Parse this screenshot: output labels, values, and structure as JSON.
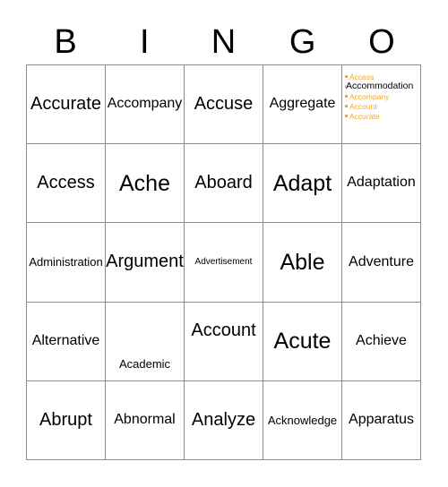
{
  "card": {
    "header_letters": [
      "B",
      "I",
      "N",
      "G",
      "O"
    ],
    "rows": [
      [
        {
          "text": "Accurate",
          "size": "sz-lg",
          "align": "middle"
        },
        {
          "text": "Accompany",
          "size": "sz-md",
          "align": "middle"
        },
        {
          "text": "Accuse",
          "size": "sz-lg",
          "align": "middle"
        },
        {
          "text": "Aggregate",
          "size": "sz-md",
          "align": "middle"
        },
        {
          "text": "",
          "size": "sz-md",
          "align": "middle"
        }
      ],
      [
        {
          "text": "Access",
          "size": "sz-lg",
          "align": "middle"
        },
        {
          "text": "Ache",
          "size": "sz-xl",
          "align": "middle"
        },
        {
          "text": "Aboard",
          "size": "sz-lg",
          "align": "middle"
        },
        {
          "text": "Adapt",
          "size": "sz-xl",
          "align": "middle"
        },
        {
          "text": "Adaptation",
          "size": "sz-md",
          "align": "middle"
        }
      ],
      [
        {
          "text": "Administration",
          "size": "sz-sm",
          "align": "middle"
        },
        {
          "text": "Argument",
          "size": "sz-lg",
          "align": "middle"
        },
        {
          "text": "Advertisement",
          "size": "sz-xs",
          "align": "middle"
        },
        {
          "text": "Able",
          "size": "sz-xl",
          "align": "middle"
        },
        {
          "text": "Adventure",
          "size": "sz-md",
          "align": "middle"
        }
      ],
      [
        {
          "text": "Alternative",
          "size": "sz-md",
          "align": "middle"
        },
        {
          "text": "Academic",
          "size": "sz-sm",
          "align": "down"
        },
        {
          "text": "Account",
          "size": "sz-lg",
          "align": "up"
        },
        {
          "text": "Acute",
          "size": "sz-xl",
          "align": "middle"
        },
        {
          "text": "Achieve",
          "size": "sz-md",
          "align": "middle"
        }
      ],
      [
        {
          "text": "Abrupt",
          "size": "sz-lg",
          "align": "middle"
        },
        {
          "text": "Abnormal",
          "size": "sz-md",
          "align": "middle"
        },
        {
          "text": "Analyze",
          "size": "sz-lg",
          "align": "middle"
        },
        {
          "text": "Acknowledge",
          "size": "sz-sm",
          "align": "middle"
        },
        {
          "text": "Apparatus",
          "size": "sz-md",
          "align": "middle"
        }
      ]
    ]
  },
  "autocomplete": {
    "input_value": "Accommodation",
    "suggestions": [
      "Access",
      "Accommodation",
      "Accompany",
      "Account",
      "Accurate"
    ],
    "accent_color": "#f5a623",
    "text_color": "#000000"
  },
  "colors": {
    "grid_line": "#8c8c8c",
    "background": "#ffffff",
    "text": "#000000",
    "suggestion": "#f5a623"
  }
}
